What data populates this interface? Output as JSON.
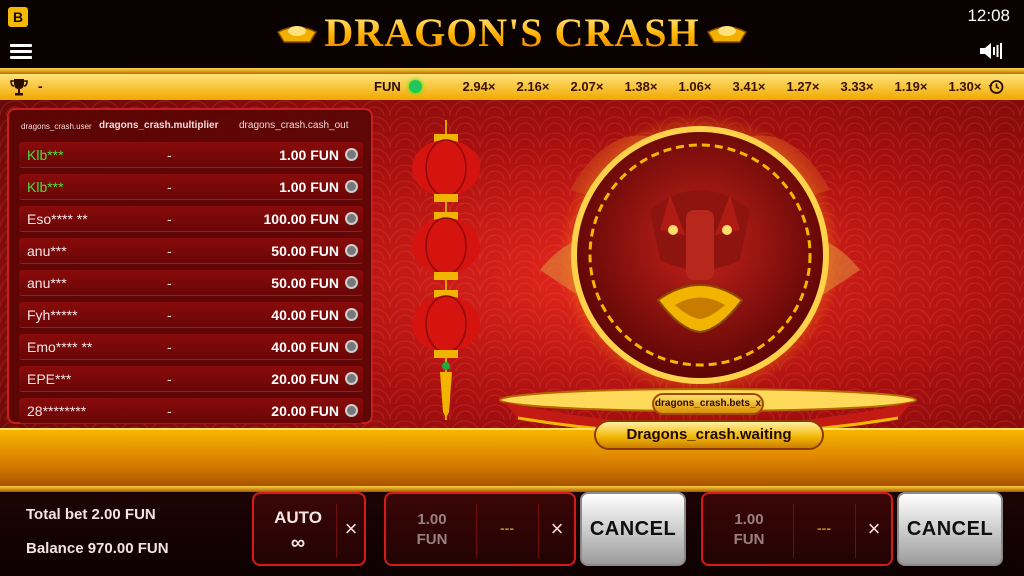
{
  "header": {
    "brand_badge": "B",
    "title": "DRAGON'S CRASH",
    "clock": "12:08"
  },
  "multiplier_bar": {
    "trophy_value": "-",
    "currency_label": "FUN",
    "history": [
      "2.94×",
      "2.16×",
      "2.07×",
      "1.38×",
      "1.06×",
      "3.41×",
      "1.27×",
      "3.33×",
      "1.19×",
      "1.30×"
    ]
  },
  "bets_table": {
    "columns": {
      "user": "dragons_crash.user",
      "multiplier": "dragons_crash.multiplier",
      "cash_out": "dragons_crash.cash_out"
    },
    "rows": [
      {
        "user": "Klb***",
        "multiplier": "-",
        "cash_out": "1.00 FUN",
        "highlight": true
      },
      {
        "user": "Klb***",
        "multiplier": "-",
        "cash_out": "1.00 FUN",
        "highlight": true
      },
      {
        "user": "Eso**** **",
        "multiplier": "-",
        "cash_out": "100.00 FUN",
        "highlight": false
      },
      {
        "user": "anu***",
        "multiplier": "-",
        "cash_out": "50.00 FUN",
        "highlight": false
      },
      {
        "user": "anu***",
        "multiplier": "-",
        "cash_out": "50.00 FUN",
        "highlight": false
      },
      {
        "user": "Fyh*****",
        "multiplier": "-",
        "cash_out": "40.00 FUN",
        "highlight": false
      },
      {
        "user": "Emo**** **",
        "multiplier": "-",
        "cash_out": "40.00 FUN",
        "highlight": false
      },
      {
        "user": "EPE***",
        "multiplier": "-",
        "cash_out": "20.00 FUN",
        "highlight": false
      },
      {
        "user": "28********",
        "multiplier": "-",
        "cash_out": "20.00 FUN",
        "highlight": false
      }
    ]
  },
  "scene": {
    "bets_x_label": "dragons_crash.bets_x",
    "status": "Dragons_crash.waiting"
  },
  "footer": {
    "total_bet": "Total bet 2.00 FUN",
    "balance": "Balance 970.00 FUN",
    "auto": {
      "label": "AUTO",
      "symbol": "∞",
      "close": "×"
    },
    "bet_panels": [
      {
        "amount_line1": "1.00",
        "amount_line2": "FUN",
        "placeholder": "---",
        "close": "×",
        "cancel_label": "CANCEL"
      },
      {
        "amount_line1": "1.00",
        "amount_line2": "FUN",
        "placeholder": "---",
        "close": "×",
        "cancel_label": "CANCEL"
      }
    ]
  },
  "colors": {
    "accent_gold": "#f5b800",
    "panel_red": "#d61a1a",
    "highlight_user": "#4ade3a",
    "status_dot": "#22c55e"
  },
  "icons": [
    "menu-icon",
    "sound-icon",
    "trophy-icon",
    "history-icon",
    "coin-icon",
    "close-icon"
  ]
}
